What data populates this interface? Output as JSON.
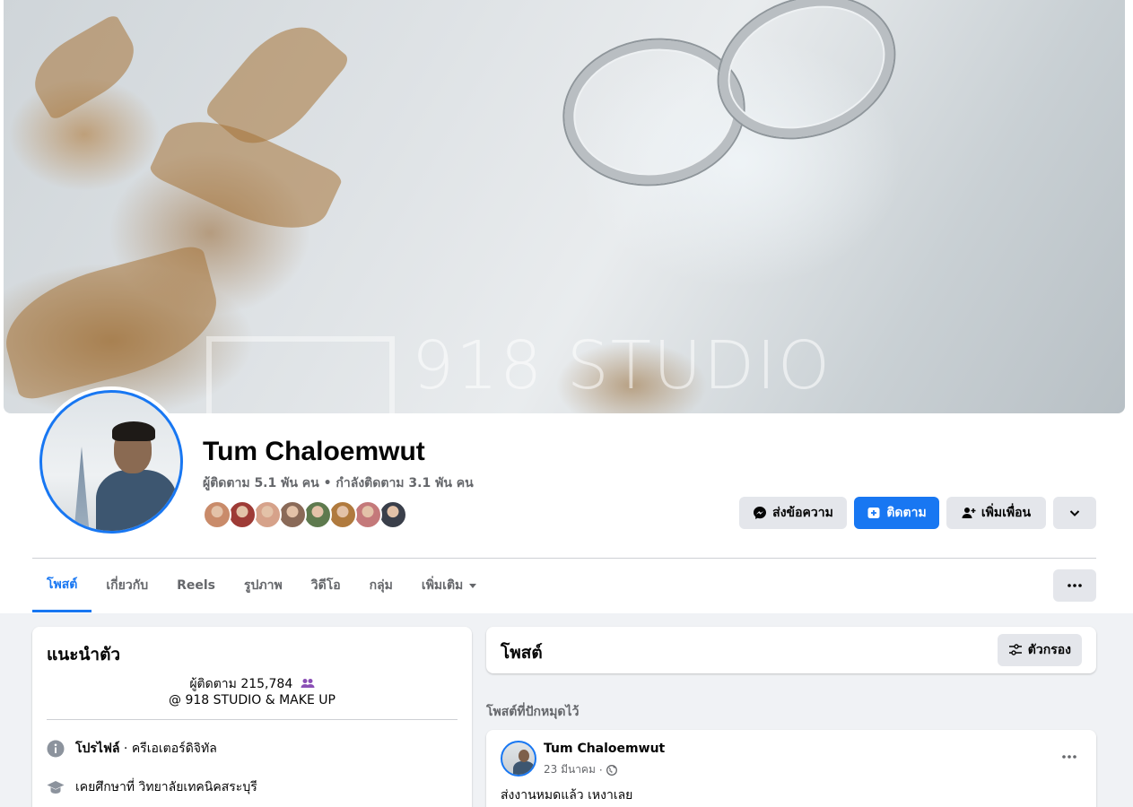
{
  "cover": {
    "watermark": "918 STUDIO"
  },
  "profile": {
    "name": "Tum Chaloemwut",
    "stats": "ผู้ติดตาม 5.1 พัน คน • กำลังติดตาม 3.1 พัน คน",
    "friend_avatar_colors": [
      "#c98b6a",
      "#9e3b36",
      "#d6a28a",
      "#8a6a58",
      "#5e7a4e",
      "#b07a3e",
      "#c4797a",
      "#3a3f4a"
    ]
  },
  "actions": {
    "message": "ส่งข้อความ",
    "follow": "ติดตาม",
    "add_friend": "เพิ่มเพื่อน"
  },
  "tabs": [
    {
      "label": "โพสต์",
      "active": true
    },
    {
      "label": "เกี่ยวกับ"
    },
    {
      "label": "Reels"
    },
    {
      "label": "รูปภาพ"
    },
    {
      "label": "วิดีโอ"
    },
    {
      "label": "กลุ่ม"
    },
    {
      "label": "เพิ่มเติม"
    }
  ],
  "intro": {
    "title": "แนะนำตัว",
    "followers": "ผู้ติดตาม 215,784",
    "workplace": "@ 918 STUDIO & MAKE UP",
    "profile_label": "โปรไฟล์",
    "profile_category": " · ครีเอเตอร์ดิจิทัล",
    "education": "เคยศึกษาที่ วิทยาลัยเทคนิคสระบุรี"
  },
  "posts": {
    "title": "โพสต์",
    "filter_label": "ตัวกรอง",
    "pinned_label": "โพสต์ที่ปักหมุดไว้",
    "items": [
      {
        "author": "Tum Chaloemwut",
        "date": "23 มีนาคม",
        "text": "ส่งงานหมดแล้ว เหงาเลย"
      }
    ]
  },
  "colors": {
    "accent": "#1877f2",
    "button_gray": "#e4e6eb",
    "background": "#f0f2f5"
  }
}
